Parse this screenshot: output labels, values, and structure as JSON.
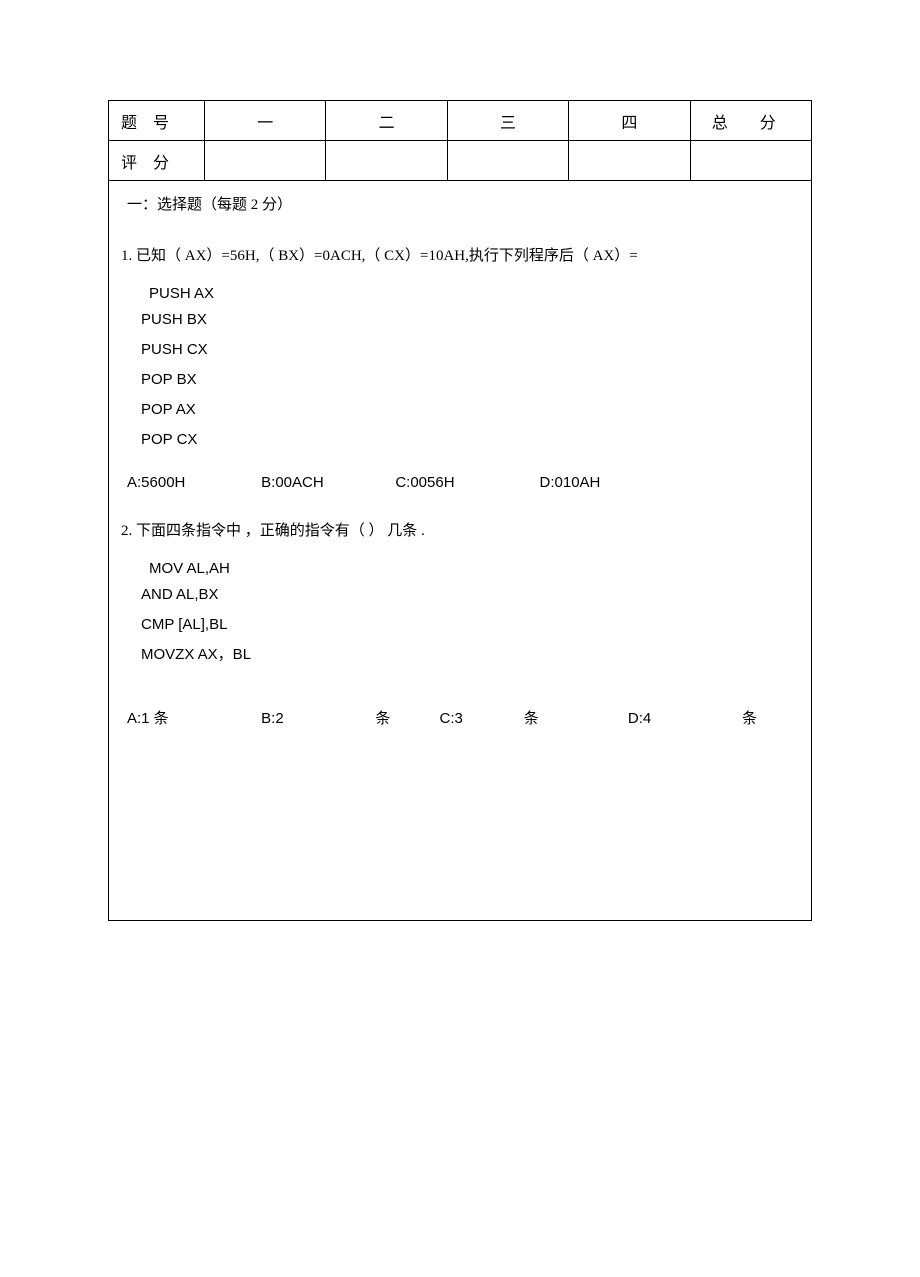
{
  "table": {
    "header_label": "题 号",
    "score_label": "评 分",
    "cols": [
      "一",
      "二",
      "三",
      "四"
    ],
    "total_label": "总  分"
  },
  "section1": {
    "title": "一：选择题（每题   2 分）"
  },
  "q1": {
    "intro_prefix": "1. 已知（ AX）=56H,（ BX）=0ACH,（ CX）=10AH,执行下列程序后（   AX）=",
    "code": [
      "PUSH AX",
      "PUSH BX",
      "PUSH CX",
      "POP  BX",
      "POP  AX",
      "POP  CX"
    ],
    "options": {
      "a": "A:5600H",
      "b": "B:00ACH",
      "c": "C:0056H",
      "d": "D:010AH"
    }
  },
  "q2": {
    "intro": "2. 下面四条指令中  ，正确的指令有（    ）   几条 .",
    "code": [
      "MOV AL,AH",
      "AND AL,BX",
      "CMP [AL],BL",
      "MOVZX AX，BL"
    ],
    "options": {
      "a_label": "A:1  条",
      "b_label": "B:2",
      "b_suffix": "条",
      "c_label": "C:3",
      "c_suffix": "条",
      "d_label": "D:4",
      "d_suffix": "条"
    }
  }
}
